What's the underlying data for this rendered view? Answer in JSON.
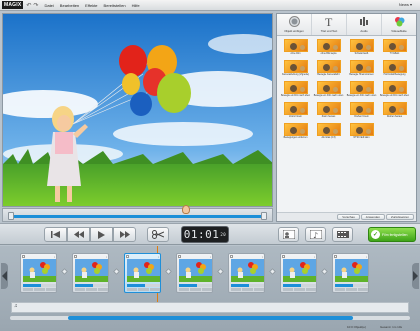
{
  "app": {
    "logo": "MAGIX",
    "news_label": "News"
  },
  "menu": [
    "Datei",
    "Bearbeiten",
    "Effekte",
    "Bereitstellen",
    "Hilfe"
  ],
  "panel_tabs": [
    {
      "label": "Objekt einfügen",
      "icon": "record-icon"
    },
    {
      "label": "Titel und Text",
      "icon": "text-icon"
    },
    {
      "label": "Audio",
      "icon": "audio-icon"
    },
    {
      "label": "Videoeffekte",
      "icon": "effects-icon"
    }
  ],
  "effects": [
    "ohne Film",
    "ohne Bild sepia",
    "Schwarzweiß",
    "TV Effekt",
    "Kameradrehung (Vignette)",
    "Bewegte Kamerafahrt",
    "Bewegte Hineinzoomen",
    "Horizontal Bewegung",
    "Bewegte ein Film nach oben",
    "Bewegte ein Film nach unten",
    "Bewegte ein Film nach unten",
    "Bewegte ein Film nach oben",
    "Zoom hinein",
    "Zoom heraus",
    "Drehen hinein",
    "Drehen heraus",
    "Bewegungen entfernen",
    "Alu Glas (4:3)",
    "NTSC lädt klein"
  ],
  "panel_buttons": [
    "Vorschau",
    "Anwenden",
    "Zurücksetzen"
  ],
  "transport": {
    "timecode": "01:01",
    "frames": "20"
  },
  "export_label": "Film fertigstellen",
  "status": {
    "left": "10:0 Objekt(e)",
    "right": "Gesamt: 1m 10s"
  },
  "music_icon": "♫",
  "colors": {
    "accent": "#1c8fd8",
    "export": "#3fa419"
  }
}
